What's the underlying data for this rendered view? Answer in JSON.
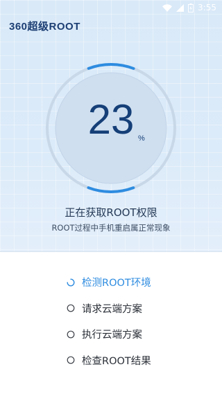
{
  "status_bar": {
    "time": "3:55",
    "icons": [
      "wifi-icon",
      "signal-icon",
      "battery-charging-icon"
    ]
  },
  "app": {
    "title": "360超级ROOT"
  },
  "progress": {
    "value": "23",
    "unit": "%",
    "fraction": 0.23
  },
  "status": {
    "title": "正在获取ROOT权限",
    "subtitle": "ROOT过程中手机重启属正常现象"
  },
  "steps": [
    {
      "label": "检测ROOT环境",
      "state": "in-progress"
    },
    {
      "label": "请求云端方案",
      "state": "pending"
    },
    {
      "label": "执行云端方案",
      "state": "pending"
    },
    {
      "label": "检查ROOT结果",
      "state": "pending"
    }
  ],
  "colors": {
    "accent": "#2e8ce0",
    "brand": "#1c3e73",
    "panel_bg": "#dcebf9",
    "text": "#2a2f37"
  }
}
